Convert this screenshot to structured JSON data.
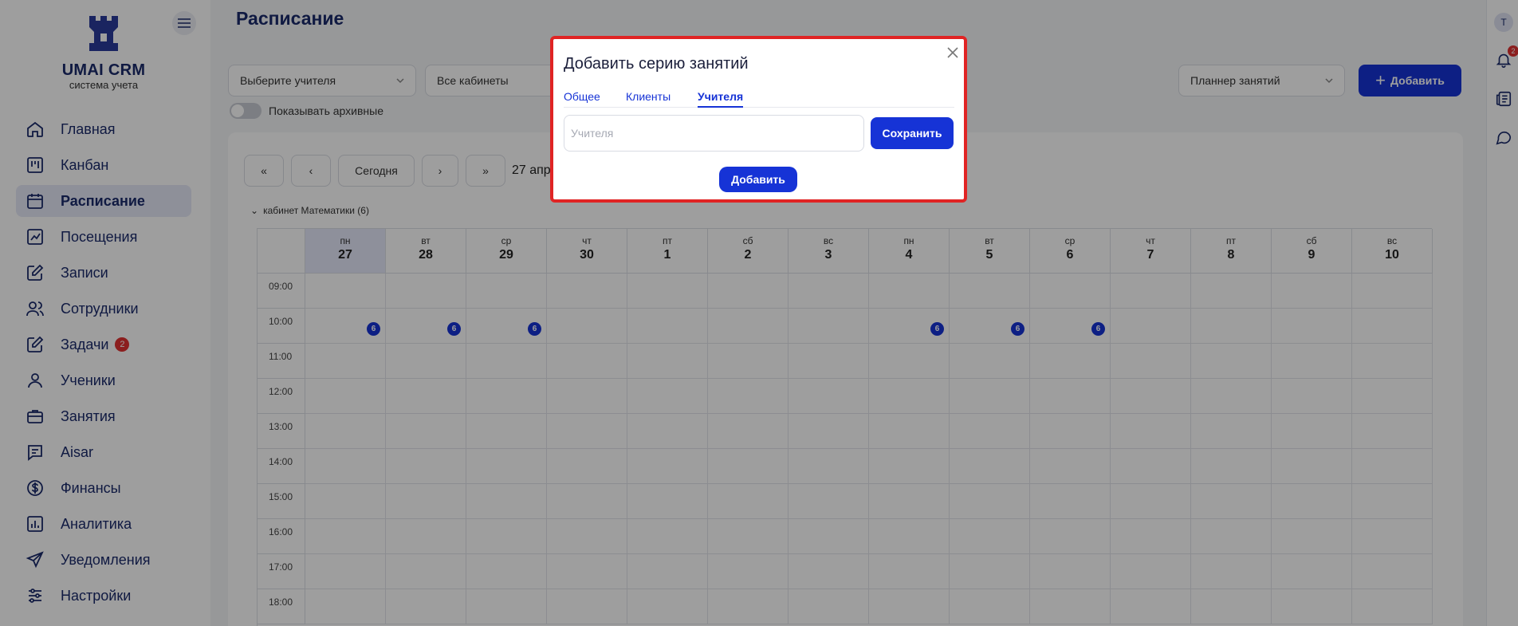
{
  "brand": {
    "title": "UMAI CRM",
    "subtitle": "система учета"
  },
  "sidebar": {
    "items": [
      {
        "label": "Главная",
        "icon": "home-icon"
      },
      {
        "label": "Канбан",
        "icon": "kanban-icon"
      },
      {
        "label": "Расписание",
        "icon": "calendar-icon",
        "active": true
      },
      {
        "label": "Посещения",
        "icon": "chart-check-icon"
      },
      {
        "label": "Записи",
        "icon": "edit-icon"
      },
      {
        "label": "Сотрудники",
        "icon": "users-icon"
      },
      {
        "label": "Задачи",
        "icon": "task-icon",
        "badge": "2"
      },
      {
        "label": "Ученики",
        "icon": "user-icon"
      },
      {
        "label": "Занятия",
        "icon": "briefcase-icon"
      },
      {
        "label": "Aisar",
        "icon": "message-icon"
      },
      {
        "label": "Финансы",
        "icon": "dollar-icon"
      },
      {
        "label": "Аналитика",
        "icon": "analytics-icon"
      },
      {
        "label": "Уведомления",
        "icon": "send-icon"
      },
      {
        "label": "Настройки",
        "icon": "settings-icon"
      }
    ]
  },
  "header": {
    "title": "Расписание"
  },
  "filters": {
    "teacher": "Выберите учителя",
    "rooms": "Все кабинеты",
    "show_archived": "Показывать архивные",
    "planner": "Планнер занятий",
    "add_label": "Добавить"
  },
  "calendar": {
    "nav": {
      "first": "«",
      "prev": "‹",
      "today": "Сегодня",
      "next": "›",
      "last": "»"
    },
    "range_label": "27 апр",
    "group_label": "кабинет Математики (6)",
    "days": [
      {
        "dow": "пн",
        "num": "27",
        "today": true
      },
      {
        "dow": "вт",
        "num": "28"
      },
      {
        "dow": "ср",
        "num": "29"
      },
      {
        "dow": "чт",
        "num": "30"
      },
      {
        "dow": "пт",
        "num": "1"
      },
      {
        "dow": "сб",
        "num": "2"
      },
      {
        "dow": "вс",
        "num": "3"
      },
      {
        "dow": "пн",
        "num": "4"
      },
      {
        "dow": "вт",
        "num": "5"
      },
      {
        "dow": "ср",
        "num": "6"
      },
      {
        "dow": "чт",
        "num": "7"
      },
      {
        "dow": "пт",
        "num": "8"
      },
      {
        "dow": "сб",
        "num": "9"
      },
      {
        "dow": "вс",
        "num": "10"
      }
    ],
    "times": [
      "09:00",
      "10:00",
      "11:00",
      "12:00",
      "13:00",
      "14:00",
      "15:00",
      "16:00",
      "17:00",
      "18:00"
    ],
    "event_badge": "6",
    "event_days": [
      "27",
      "28",
      "29",
      "4",
      "5",
      "6"
    ],
    "event_time": "10:00"
  },
  "rail": {
    "avatar": "T",
    "notification_count": "2"
  },
  "modal": {
    "title": "Добавить серию занятий",
    "tabs": [
      {
        "label": "Общее"
      },
      {
        "label": "Клиенты"
      },
      {
        "label": "Учителя",
        "active": true
      }
    ],
    "input_placeholder": "Учителя",
    "input_value": "",
    "save_label": "Сохранить",
    "add_label": "Добавить"
  },
  "colors": {
    "accent": "#1633d6",
    "brand": "#1b2a6b",
    "highlight": "#e02424"
  }
}
